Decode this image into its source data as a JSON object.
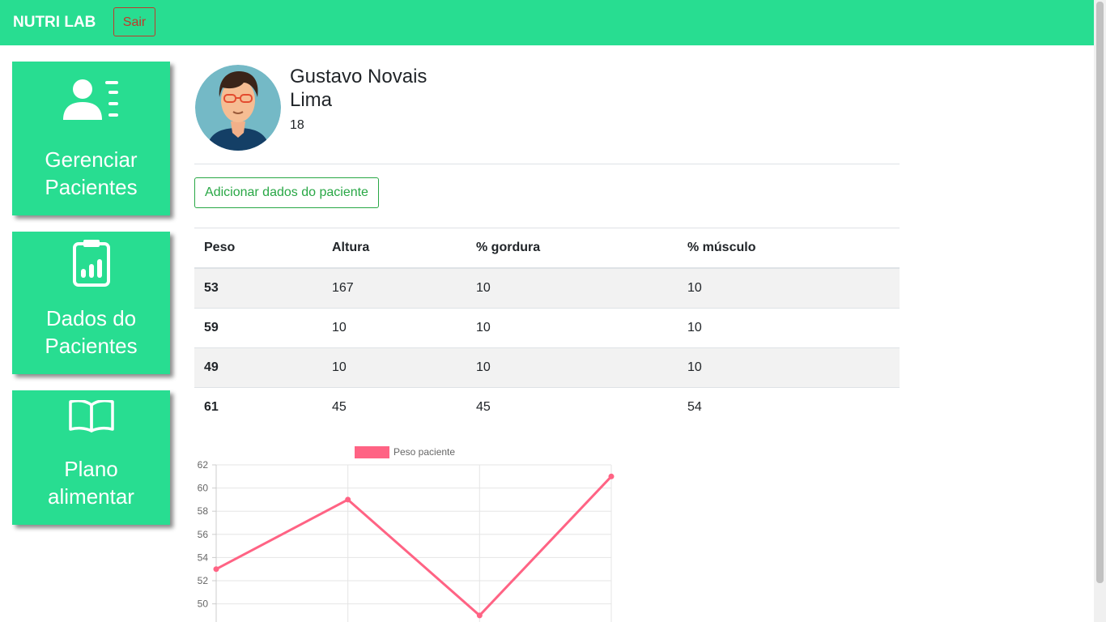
{
  "navbar": {
    "brand": "NUTRI LAB",
    "logout_label": "Sair",
    "accent": "#28dd91"
  },
  "sidebar": {
    "items": [
      {
        "label_line1": "Gerenciar",
        "label_line2": "Pacientes",
        "icon": "patients-icon"
      },
      {
        "label_line1": "Dados do",
        "label_line2": "Pacientes",
        "icon": "clipboard-chart-icon"
      },
      {
        "label_line1": "Plano",
        "label_line2": "alimentar",
        "icon": "book-icon"
      }
    ]
  },
  "patient": {
    "name_line1": "Gustavo Novais",
    "name_line2": "Lima",
    "age": "18"
  },
  "add_button_label": "Adicionar dados do paciente",
  "table": {
    "headers": [
      "Peso",
      "Altura",
      "% gordura",
      "% músculo"
    ],
    "rows": [
      [
        "53",
        "167",
        "10",
        "10"
      ],
      [
        "59",
        "10",
        "10",
        "10"
      ],
      [
        "49",
        "10",
        "10",
        "10"
      ],
      [
        "61",
        "45",
        "45",
        "54"
      ]
    ]
  },
  "chart_data": {
    "type": "line",
    "series": [
      {
        "name": "Peso paciente",
        "values": [
          53,
          59,
          49,
          61
        ],
        "color": "#ff6384"
      }
    ],
    "y_ticks": [
      "62",
      "60",
      "58",
      "56",
      "54",
      "52",
      "50"
    ],
    "ylim": [
      48,
      62
    ],
    "legend_position": "top"
  }
}
